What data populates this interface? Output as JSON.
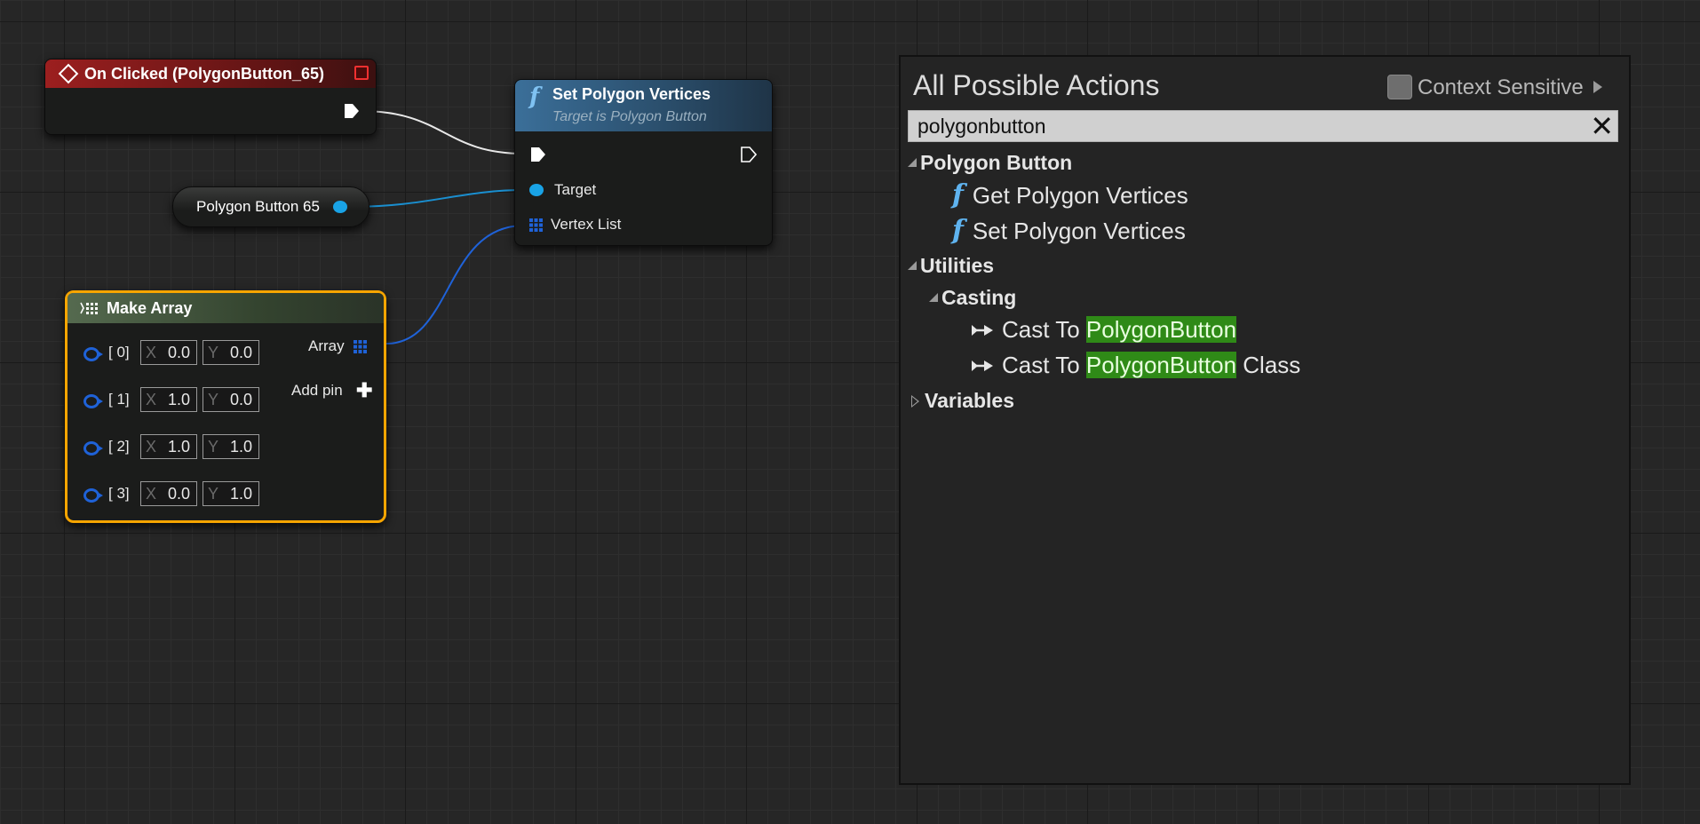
{
  "event_node": {
    "title": "On Clicked (PolygonButton_65)"
  },
  "set_node": {
    "fn_glyph": "f",
    "title": "Set Polygon Vertices",
    "subtitle": "Target is Polygon Button",
    "target_label": "Target",
    "vertex_label": "Vertex List"
  },
  "var_node": {
    "label": "Polygon Button 65"
  },
  "make_array": {
    "title": "Make Array",
    "array_label": "Array",
    "add_pin_label": "Add pin",
    "add_pin_glyph": "✚",
    "rows": [
      {
        "index": "[ 0]",
        "x_axis": "X",
        "x": "0.0",
        "y_axis": "Y",
        "y": "0.0"
      },
      {
        "index": "[ 1]",
        "x_axis": "X",
        "x": "1.0",
        "y_axis": "Y",
        "y": "0.0"
      },
      {
        "index": "[ 2]",
        "x_axis": "X",
        "x": "1.0",
        "y_axis": "Y",
        "y": "1.0"
      },
      {
        "index": "[ 3]",
        "x_axis": "X",
        "x": "0.0",
        "y_axis": "Y",
        "y": "1.0"
      }
    ]
  },
  "actions_panel": {
    "title": "All Possible Actions",
    "context_sensitive_label": "Context Sensitive",
    "search_value": "polygonbutton",
    "clear_glyph": "✕",
    "categories": {
      "polygon_button": "Polygon Button",
      "utilities": "Utilities",
      "casting": "Casting",
      "variables": "Variables"
    },
    "function_glyph": "f",
    "items": {
      "get_vertices": "Get Polygon Vertices",
      "set_vertices": "Set Polygon Vertices",
      "cast_prefix": "Cast To ",
      "cast_highlight": "PolygonButton",
      "cast_class_suffix": " Class"
    }
  },
  "colors": {
    "event_header": "#9c1f1f",
    "function_header": "#3b6f99",
    "make_array_header": "#556a4f",
    "selection_outline": "#f7a500",
    "object_pin": "#19a3e6",
    "array_pin": "#1f62d8",
    "search_highlight": "#2f8a17"
  },
  "icons": {
    "event": "event-diamond-icon",
    "function": "function-icon",
    "array": "array-grid-icon",
    "cast": "cast-arrow-icon"
  }
}
